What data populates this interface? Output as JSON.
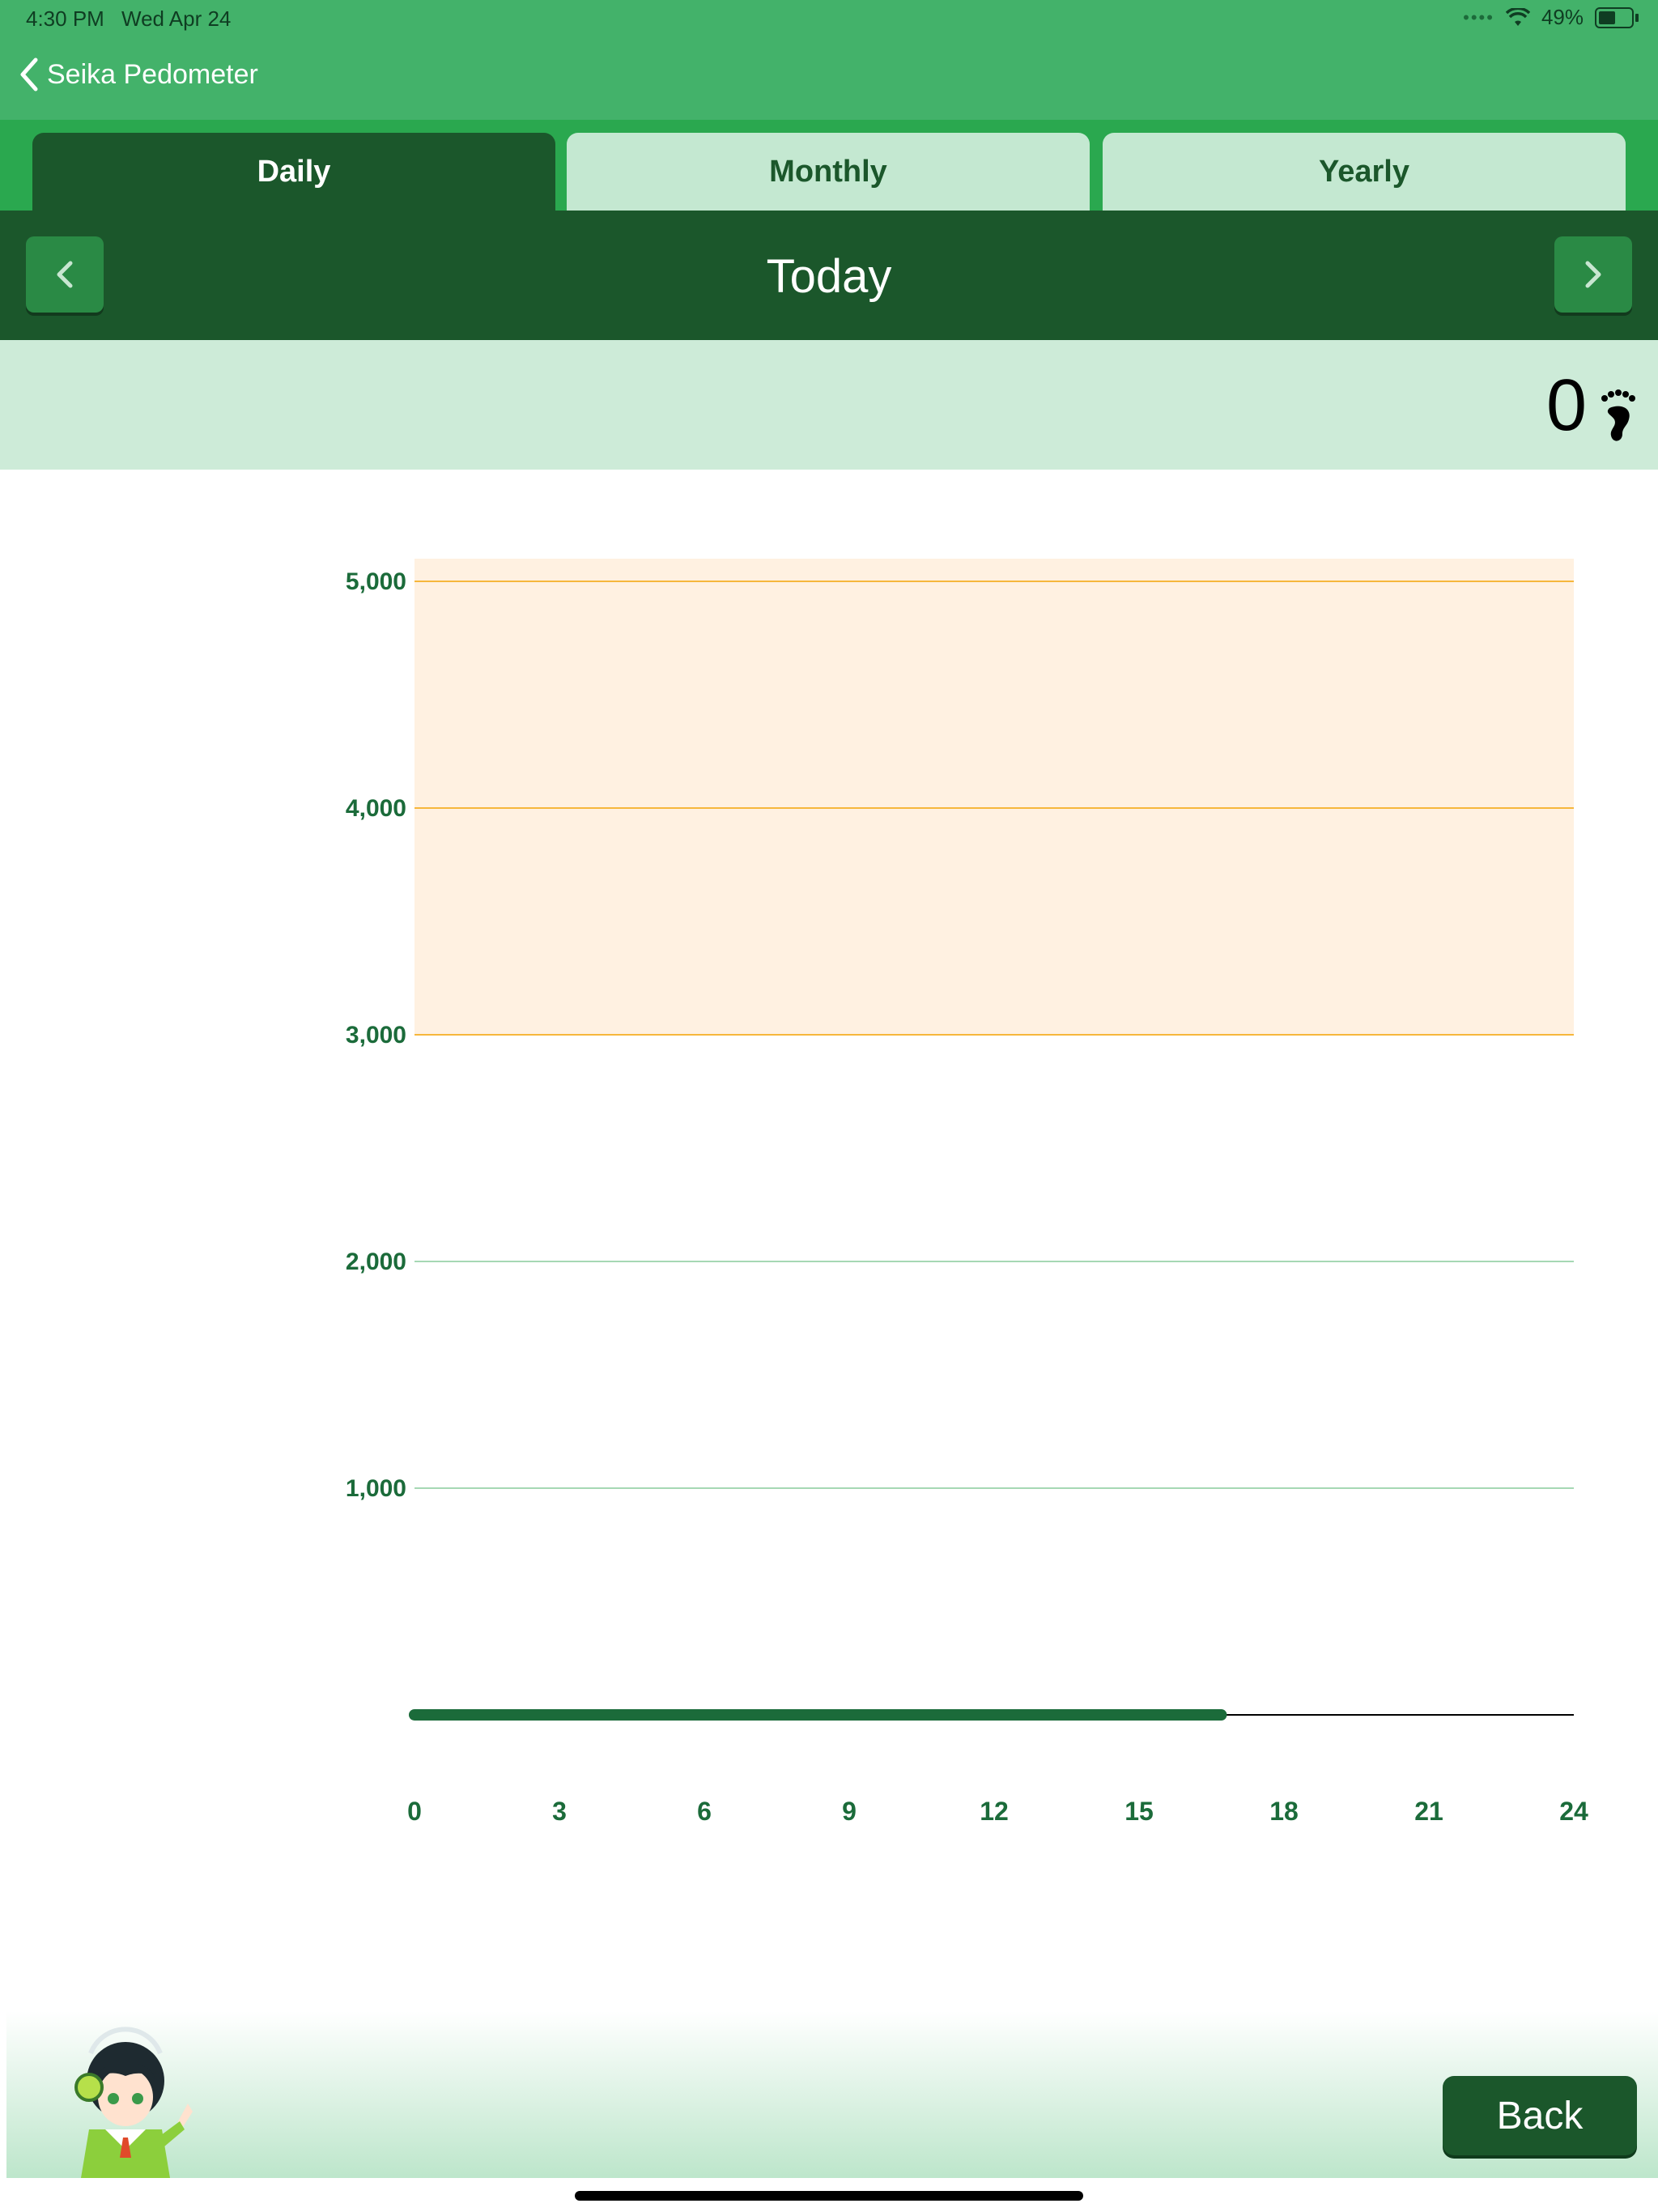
{
  "status": {
    "time": "4:30 PM",
    "date": "Wed Apr 24",
    "battery": "49%"
  },
  "nav": {
    "back_label": "Seika Pedometer"
  },
  "tabs": [
    {
      "label": "Daily",
      "selected": true
    },
    {
      "label": "Monthly",
      "selected": false
    },
    {
      "label": "Yearly",
      "selected": false
    }
  ],
  "day": {
    "title": "Today"
  },
  "total": {
    "steps": "0"
  },
  "chart_data": {
    "type": "line",
    "title": "",
    "xlabel": "",
    "ylabel": "",
    "x_ticks": [
      "0",
      "3",
      "6",
      "9",
      "12",
      "15",
      "18",
      "21",
      "24"
    ],
    "y_ticks": [
      "1,000",
      "2,000",
      "3,000",
      "4,000",
      "5,000"
    ],
    "y_tick_values": [
      1000,
      2000,
      3000,
      4000,
      5000
    ],
    "xlim": [
      0,
      24
    ],
    "ylim": [
      0,
      5100
    ],
    "goal_band": [
      3000,
      5100
    ],
    "series": [
      {
        "x": [
          0,
          16.7
        ],
        "y": [
          0,
          0
        ]
      }
    ],
    "colors": {
      "band": "#fff1e1",
      "band_lines": "#f6b73c",
      "grid": "#a6d8b4",
      "line": "#1b6b3a",
      "axis": "#000000",
      "ticks": "#1b6b3a"
    }
  },
  "footer": {
    "back_label": "Back"
  }
}
